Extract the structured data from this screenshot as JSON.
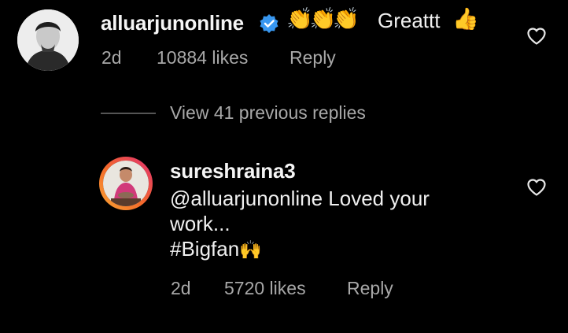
{
  "comment": {
    "username": "alluarjunonline",
    "verified": true,
    "emoji_clap": "👏",
    "text": "Greattt",
    "emoji_thumb": "👍",
    "time": "2d",
    "likes": "10884 likes",
    "reply_label": "Reply"
  },
  "view_replies_label": "View 41 previous replies",
  "reply": {
    "username": "sureshraina3",
    "text_line1": "@alluarjunonline Loved your",
    "text_line2": "work...",
    "text_line3": "#Bigfan",
    "emoji_raised_hands": "🙌",
    "time": "2d",
    "likes": "5720 likes",
    "reply_label": "Reply"
  },
  "colors": {
    "background": "#000000",
    "verified_blue": "#3897f0",
    "meta_gray": "#a8a8a8",
    "story_ring": "#f46b2a"
  }
}
